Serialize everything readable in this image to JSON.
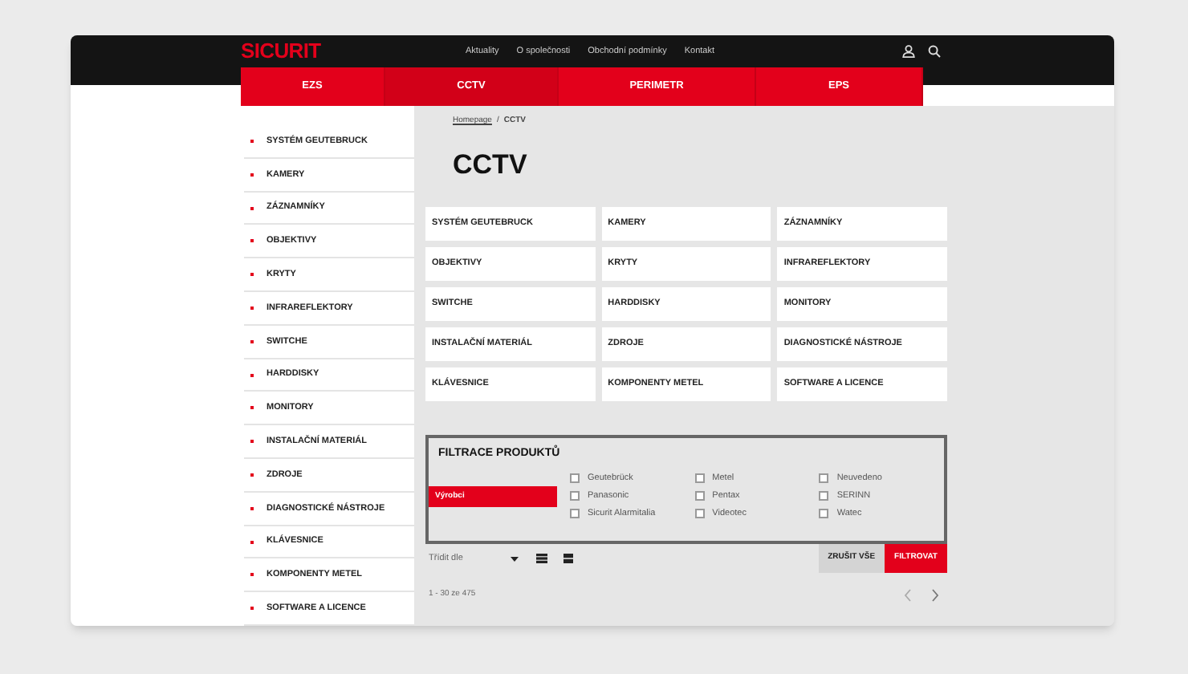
{
  "header": {
    "logo": "SICURIT",
    "menu": [
      "Aktuality",
      "O společnosti",
      "Obchodní podmínky",
      "Kontakt"
    ]
  },
  "nav": [
    {
      "label": "EZS",
      "selected": false
    },
    {
      "label": "CCTV",
      "selected": true
    },
    {
      "label": "PERIMETR",
      "selected": false
    },
    {
      "label": "EPS",
      "selected": false
    }
  ],
  "sidebar": {
    "items": [
      "SYSTÉM GEUTEBRUCK",
      "KAMERY",
      "ZÁZNAMNÍKY",
      "OBJEKTIVY",
      "KRYTY",
      "INFRAREFLEKTORY",
      "SWITCHE",
      "HARDDISKY",
      "MONITORY",
      "INSTALAČNÍ MATERIÁL",
      "ZDROJE",
      "DIAGNOSTICKÉ NÁSTROJE",
      "KLÁVESNICE",
      "KOMPONENTY METEL",
      "SOFTWARE A LICENCE"
    ]
  },
  "breadcrumb": {
    "items": [
      "Homepage",
      "CCTV"
    ],
    "separator": "/"
  },
  "title": "CCTV",
  "categories": [
    "SYSTÉM GEUTEBRUCK",
    "KAMERY",
    "ZÁZNAMNÍKY",
    "OBJEKTIVY",
    "KRYTY",
    "INFRAREFLEKTORY",
    "SWITCHE",
    "HARDDISKY",
    "MONITORY",
    "INSTALAČNÍ MATERIÁL",
    "ZDROJE",
    "DIAGNOSTICKÉ NÁSTROJE",
    "KLÁVESNICE",
    "KOMPONENTY METEL",
    "SOFTWARE A LICENCE"
  ],
  "filter": {
    "title": "FILTRACE PRODUKTŮ",
    "tabs": [
      {
        "label": "Výrobci",
        "selected": true
      }
    ],
    "options": [
      {
        "label": "Geutebrück",
        "checked": false
      },
      {
        "label": "Panasonic",
        "checked": false
      },
      {
        "label": "Sicurit Alarmitalia",
        "checked": false
      },
      {
        "label": "Metel",
        "checked": false
      },
      {
        "label": "Pentax",
        "checked": false
      },
      {
        "label": "Videotec",
        "checked": false
      },
      {
        "label": "Neuvedeno",
        "checked": false
      },
      {
        "label": "SERINN",
        "checked": false
      },
      {
        "label": "Watec",
        "checked": false
      }
    ],
    "reset": "ZRUŠIT VŠE",
    "submit": "FILTROVAT"
  },
  "sort": {
    "label": "Třídit dle"
  },
  "pagination": {
    "summary": "1 - 30 ze 475"
  }
}
